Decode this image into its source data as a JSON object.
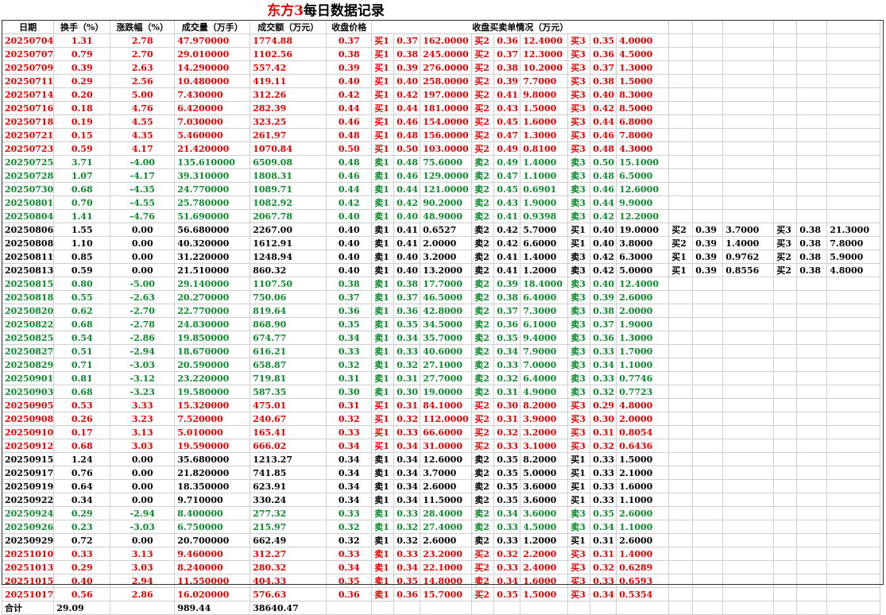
{
  "title": {
    "name": "东方3",
    "rest": "每日数据记录"
  },
  "headers": [
    "日期",
    "换手（%）",
    "涨跌幅（%）",
    "成交量（万手）",
    "成交额（万元）",
    "收盘价格",
    "收盘买卖单情况（万元）"
  ],
  "colors": {
    "up": "#e60000",
    "down": "#0a8a2a",
    "flat": "#000000"
  },
  "rows": [
    {
      "c": "red",
      "v": [
        "20250704",
        "1.31",
        "2.78",
        "47.970000",
        "1774.88",
        "0.37",
        "买1",
        "0.37",
        "162.0000",
        "买2",
        "0.36",
        "12.4000",
        "买3",
        "0.35",
        "4.0000"
      ]
    },
    {
      "c": "red",
      "v": [
        "20250707",
        "0.79",
        "2.70",
        "29.010000",
        "1102.56",
        "0.38",
        "买1",
        "0.38",
        "245.0000",
        "买2",
        "0.37",
        "12.3000",
        "买3",
        "0.36",
        "4.5000"
      ]
    },
    {
      "c": "red",
      "v": [
        "20250709",
        "0.39",
        "2.63",
        "14.290000",
        "557.42",
        "0.39",
        "买1",
        "0.39",
        "276.0000",
        "买2",
        "0.38",
        "10.2000",
        "买3",
        "0.37",
        "1.3000"
      ]
    },
    {
      "c": "red",
      "v": [
        "20250711",
        "0.29",
        "2.56",
        "10.480000",
        "419.11",
        "0.40",
        "买1",
        "0.40",
        "258.0000",
        "买2",
        "0.39",
        "7.7000",
        "买3",
        "0.38",
        "1.5000"
      ]
    },
    {
      "c": "red",
      "v": [
        "20250714",
        "0.20",
        "5.00",
        "7.430000",
        "312.26",
        "0.42",
        "买1",
        "0.42",
        "197.0000",
        "买2",
        "0.41",
        "9.8000",
        "买3",
        "0.40",
        "8.3000"
      ]
    },
    {
      "c": "red",
      "v": [
        "20250716",
        "0.18",
        "4.76",
        "6.420000",
        "282.39",
        "0.44",
        "买1",
        "0.44",
        "181.0000",
        "买2",
        "0.43",
        "1.5000",
        "买3",
        "0.42",
        "8.5000"
      ]
    },
    {
      "c": "red",
      "v": [
        "20250718",
        "0.19",
        "4.55",
        "7.030000",
        "323.25",
        "0.46",
        "买1",
        "0.46",
        "154.0000",
        "买2",
        "0.45",
        "1.6000",
        "买3",
        "0.44",
        "6.8000"
      ]
    },
    {
      "c": "red",
      "v": [
        "20250721",
        "0.15",
        "4.35",
        "5.460000",
        "261.97",
        "0.48",
        "买1",
        "0.48",
        "156.0000",
        "买2",
        "0.47",
        "1.3000",
        "买3",
        "0.46",
        "7.8000"
      ]
    },
    {
      "c": "red",
      "v": [
        "20250723",
        "0.59",
        "4.17",
        "21.420000",
        "1070.84",
        "0.50",
        "买1",
        "0.50",
        "103.0000",
        "买2",
        "0.49",
        "0.8100",
        "买3",
        "0.48",
        "4.3000"
      ]
    },
    {
      "c": "green",
      "v": [
        "20250725",
        "3.71",
        "-4.00",
        "135.610000",
        "6509.08",
        "0.48",
        "卖1",
        "0.48",
        "75.6000",
        "卖2",
        "0.49",
        "1.4000",
        "卖3",
        "0.50",
        "15.1000"
      ]
    },
    {
      "c": "green",
      "v": [
        "20250728",
        "1.07",
        "-4.17",
        "39.310000",
        "1808.31",
        "0.46",
        "卖1",
        "0.46",
        "129.0000",
        "卖2",
        "0.47",
        "1.1000",
        "卖3",
        "0.48",
        "6.5000"
      ]
    },
    {
      "c": "green",
      "v": [
        "20250730",
        "0.68",
        "-4.35",
        "24.770000",
        "1089.71",
        "0.44",
        "卖1",
        "0.44",
        "121.0000",
        "卖2",
        "0.45",
        "0.6901",
        "卖3",
        "0.46",
        "12.6000"
      ]
    },
    {
      "c": "green",
      "v": [
        "20250801",
        "0.70",
        "-4.55",
        "25.780000",
        "1082.92",
        "0.42",
        "卖1",
        "0.42",
        "90.2000",
        "卖2",
        "0.43",
        "1.9000",
        "卖3",
        "0.44",
        "9.9000"
      ]
    },
    {
      "c": "green",
      "v": [
        "20250804",
        "1.41",
        "-4.76",
        "51.690000",
        "2067.78",
        "0.40",
        "卖1",
        "0.40",
        "48.9000",
        "卖2",
        "0.41",
        "0.9398",
        "卖3",
        "0.42",
        "12.2000"
      ]
    },
    {
      "c": "black",
      "v": [
        "20250806",
        "1.55",
        "0.00",
        "56.680000",
        "2267.00",
        "0.40",
        "卖1",
        "0.41",
        "0.6527",
        "卖2",
        "0.42",
        "5.7000",
        "买1",
        "0.40",
        "19.0000",
        "买2",
        "0.39",
        "3.7000",
        "买3",
        "0.38",
        "21.3000"
      ]
    },
    {
      "c": "black",
      "v": [
        "20250808",
        "1.10",
        "0.00",
        "40.320000",
        "1612.91",
        "0.40",
        "卖1",
        "0.41",
        "2.0000",
        "卖2",
        "0.42",
        "6.6000",
        "买1",
        "0.40",
        "3.8000",
        "买2",
        "0.39",
        "1.4000",
        "买3",
        "0.38",
        "7.8000"
      ]
    },
    {
      "c": "black",
      "v": [
        "20250811",
        "0.85",
        "0.00",
        "31.220000",
        "1248.94",
        "0.40",
        "卖1",
        "0.40",
        "3.2000",
        "卖2",
        "0.41",
        "1.4000",
        "卖3",
        "0.42",
        "6.3000",
        "买1",
        "0.39",
        "0.9762",
        "买2",
        "0.38",
        "5.9000"
      ]
    },
    {
      "c": "black",
      "v": [
        "20250813",
        "0.59",
        "0.00",
        "21.510000",
        "860.32",
        "0.40",
        "卖1",
        "0.40",
        "13.2000",
        "卖2",
        "0.41",
        "1.2000",
        "卖3",
        "0.42",
        "5.0000",
        "买1",
        "0.39",
        "0.8556",
        "买2",
        "0.38",
        "4.8000"
      ]
    },
    {
      "c": "green",
      "v": [
        "20250815",
        "0.80",
        "-5.00",
        "29.140000",
        "1107.50",
        "0.38",
        "卖1",
        "0.38",
        "17.7000",
        "卖2",
        "0.39",
        "18.4000",
        "卖3",
        "0.40",
        "12.4000"
      ]
    },
    {
      "c": "green",
      "v": [
        "20250818",
        "0.55",
        "-2.63",
        "20.270000",
        "750.06",
        "0.37",
        "卖1",
        "0.37",
        "46.5000",
        "卖2",
        "0.38",
        "6.4000",
        "卖3",
        "0.39",
        "2.6000"
      ]
    },
    {
      "c": "green",
      "v": [
        "20250820",
        "0.62",
        "-2.70",
        "22.770000",
        "819.64",
        "0.36",
        "卖1",
        "0.36",
        "42.8000",
        "卖2",
        "0.37",
        "7.3000",
        "卖3",
        "0.38",
        "2.0000"
      ]
    },
    {
      "c": "green",
      "v": [
        "20250822",
        "0.68",
        "-2.78",
        "24.830000",
        "868.90",
        "0.35",
        "卖1",
        "0.35",
        "34.5000",
        "卖2",
        "0.36",
        "6.1000",
        "卖3",
        "0.37",
        "1.9000"
      ]
    },
    {
      "c": "green",
      "v": [
        "20250825",
        "0.54",
        "-2.86",
        "19.850000",
        "674.77",
        "0.34",
        "卖1",
        "0.34",
        "35.7000",
        "卖2",
        "0.35",
        "9.4000",
        "卖3",
        "0.36",
        "1.3000"
      ]
    },
    {
      "c": "green",
      "v": [
        "20250827",
        "0.51",
        "-2.94",
        "18.670000",
        "616.21",
        "0.33",
        "卖1",
        "0.33",
        "40.6000",
        "卖2",
        "0.34",
        "7.9000",
        "卖3",
        "0.33",
        "1.7000"
      ]
    },
    {
      "c": "green",
      "v": [
        "20250829",
        "0.71",
        "-3.03",
        "20.590000",
        "658.87",
        "0.32",
        "卖1",
        "0.32",
        "27.1000",
        "卖2",
        "0.33",
        "7.0000",
        "卖3",
        "0.34",
        "1.1000"
      ]
    },
    {
      "c": "green",
      "v": [
        "20250901",
        "0.81",
        "-3.12",
        "23.220000",
        "719.81",
        "0.31",
        "卖1",
        "0.31",
        "27.7000",
        "卖2",
        "0.32",
        "6.4000",
        "卖3",
        "0.33",
        "0.7746"
      ]
    },
    {
      "c": "green",
      "v": [
        "20250903",
        "0.68",
        "-3.23",
        "19.580000",
        "587.35",
        "0.30",
        "卖1",
        "0.30",
        "19.0000",
        "卖2",
        "0.31",
        "4.9000",
        "卖3",
        "0.32",
        "0.7723"
      ]
    },
    {
      "c": "red",
      "v": [
        "20250905",
        "0.53",
        "3.33",
        "15.320000",
        "475.01",
        "0.31",
        "买1",
        "0.31",
        "84.1000",
        "买2",
        "0.30",
        "8.2000",
        "买3",
        "0.29",
        "4.8000"
      ]
    },
    {
      "c": "red",
      "v": [
        "20250908",
        "0.26",
        "3.23",
        "7.520000",
        "240.67",
        "0.32",
        "买1",
        "0.32",
        "112.0000",
        "买2",
        "0.31",
        "3.9000",
        "买3",
        "0.30",
        "2.0000"
      ]
    },
    {
      "c": "red",
      "v": [
        "20250910",
        "0.17",
        "3.13",
        "5.010000",
        "165.41",
        "0.33",
        "买1",
        "0.33",
        "66.6000",
        "买2",
        "0.32",
        "3.2000",
        "买3",
        "0.31",
        "0.8054"
      ]
    },
    {
      "c": "red",
      "v": [
        "20250912",
        "0.68",
        "3.03",
        "19.590000",
        "666.02",
        "0.34",
        "买1",
        "0.34",
        "31.0000",
        "买2",
        "0.33",
        "3.1000",
        "买3",
        "0.32",
        "0.6436"
      ]
    },
    {
      "c": "black",
      "v": [
        "20250915",
        "1.24",
        "0.00",
        "35.680000",
        "1213.27",
        "0.34",
        "卖1",
        "0.34",
        "12.6000",
        "卖2",
        "0.35",
        "8.2000",
        "买1",
        "0.33",
        "1.5000"
      ]
    },
    {
      "c": "black",
      "v": [
        "20250917",
        "0.76",
        "0.00",
        "21.820000",
        "741.85",
        "0.34",
        "卖1",
        "0.34",
        "3.7000",
        "卖2",
        "0.35",
        "5.0000",
        "买1",
        "0.33",
        "2.1000"
      ]
    },
    {
      "c": "black",
      "v": [
        "20250919",
        "0.64",
        "0.00",
        "18.350000",
        "623.91",
        "0.34",
        "卖1",
        "0.34",
        "2.6000",
        "卖2",
        "0.35",
        "3.6000",
        "买1",
        "0.33",
        "1.6000"
      ]
    },
    {
      "c": "black",
      "v": [
        "20250922",
        "0.34",
        "0.00",
        "9.710000",
        "330.24",
        "0.34",
        "卖1",
        "0.34",
        "11.5000",
        "卖2",
        "0.35",
        "3.6000",
        "买1",
        "0.33",
        "1.1000"
      ]
    },
    {
      "c": "green",
      "v": [
        "20250924",
        "0.29",
        "-2.94",
        "8.400000",
        "277.32",
        "0.33",
        "卖1",
        "0.33",
        "28.4000",
        "卖2",
        "0.34",
        "3.6000",
        "卖3",
        "0.35",
        "2.6000"
      ]
    },
    {
      "c": "green",
      "v": [
        "20250926",
        "0.23",
        "-3.03",
        "6.750000",
        "215.97",
        "0.32",
        "卖1",
        "0.32",
        "27.4000",
        "卖2",
        "0.33",
        "4.5000",
        "卖3",
        "0.34",
        "1.1000"
      ]
    },
    {
      "c": "black",
      "v": [
        "20250929",
        "0.72",
        "0.00",
        "20.700000",
        "662.49",
        "0.32",
        "卖1",
        "0.32",
        "2.6000",
        "卖2",
        "0.33",
        "1.2000",
        "买1",
        "0.31",
        "2.6000"
      ]
    },
    {
      "c": "red",
      "v": [
        "20251010",
        "0.33",
        "3.13",
        "9.460000",
        "312.27",
        "0.33",
        "卖1",
        "0.33",
        "23.2000",
        "买2",
        "0.32",
        "2.2000",
        "买3",
        "0.31",
        "1.4000"
      ]
    },
    {
      "c": "red",
      "v": [
        "20251013",
        "0.29",
        "3.03",
        "8.240000",
        "280.32",
        "0.34",
        "卖1",
        "0.34",
        "22.1000",
        "买2",
        "0.33",
        "2.4000",
        "买3",
        "0.32",
        "0.6289"
      ]
    },
    {
      "c": "red",
      "v": [
        "20251015",
        "0.40",
        "2.94",
        "11.550000",
        "404.33",
        "0.35",
        "卖1",
        "0.35",
        "14.8000",
        "卖2",
        "0.34",
        "1.6000",
        "买3",
        "0.33",
        "0.6593"
      ]
    },
    {
      "c": "red",
      "v": [
        "20251017",
        "0.56",
        "2.86",
        "16.020000",
        "576.63",
        "0.36",
        "卖1",
        "0.36",
        "15.7000",
        "买2",
        "0.35",
        "1.5000",
        "买3",
        "0.34",
        "0.5354"
      ]
    }
  ],
  "total": {
    "label": "合计",
    "turnover": "29.09",
    "volume": "989.44",
    "amount": "38640.47"
  }
}
